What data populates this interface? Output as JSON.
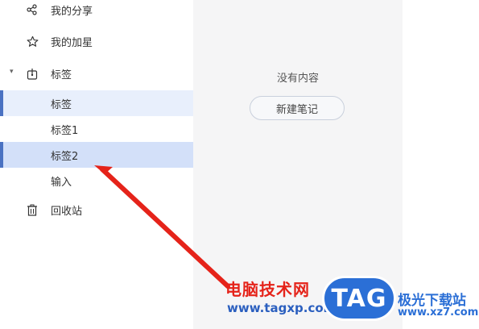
{
  "sidebar": {
    "items": [
      {
        "label": "我的分享",
        "icon": "share-icon"
      },
      {
        "label": "我的加星",
        "icon": "star-icon"
      },
      {
        "label": "标签",
        "icon": "tag-icon",
        "expanded": true
      }
    ],
    "tags": [
      {
        "label": "标签"
      },
      {
        "label": "标签1"
      },
      {
        "label": "标签2"
      },
      {
        "label": "输入"
      }
    ],
    "trash": {
      "label": "回收站",
      "icon": "trash-icon"
    }
  },
  "main": {
    "empty_text": "没有内容",
    "new_note_label": "新建笔记"
  },
  "watermark": {
    "text": "电脑技术网",
    "url": "www.tagxp.com",
    "badge": "TAG",
    "site_name": "极光下载站",
    "site_url": "www.xz7.com"
  },
  "colors": {
    "selected_bg": "#d3e0f9",
    "selected_light_bg": "#e8effc",
    "accent_bar": "#4a72c2",
    "arrow": "#e5231a"
  }
}
